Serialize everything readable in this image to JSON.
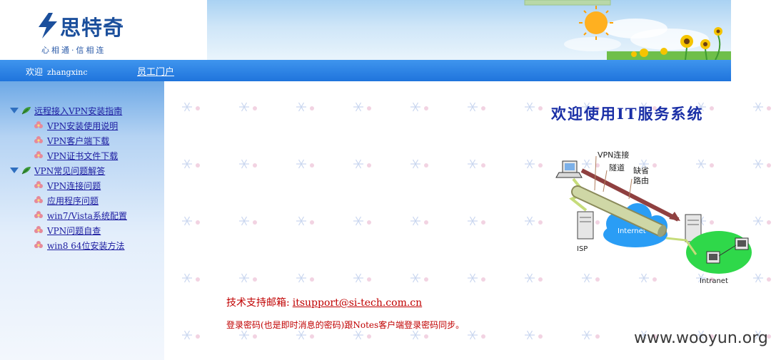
{
  "header": {
    "logo_name": "思特奇",
    "logo_slogan": "心相通·信相连"
  },
  "navbar": {
    "welcome_label": "欢迎",
    "username": "zhangxinc",
    "portal_link": "员工门户"
  },
  "sidebar": {
    "groups": [
      {
        "label": "远程接入VPN安装指南",
        "items": [
          {
            "label": "VPN安装使用说明"
          },
          {
            "label": "VPN客户端下载"
          },
          {
            "label": "VPN证书文件下载"
          }
        ]
      },
      {
        "label": "VPN常见问题解答",
        "items": [
          {
            "label": "VPN连接问题"
          },
          {
            "label": "应用程序问题"
          },
          {
            "label": "win7/Vista系统配置"
          },
          {
            "label": "VPN问题自查"
          },
          {
            "label": "win8 64位安装方法"
          }
        ]
      }
    ]
  },
  "main": {
    "title": "欢迎使用IT服务系统",
    "diagram": {
      "vpn_label": "VPN连接",
      "tunnel_label": "隧道",
      "route_label_1": "缺省",
      "route_label_2": "路由",
      "internet_label": "Internet",
      "isp_label": "ISP",
      "intranet_label": "Intranet"
    },
    "support_label": "技术支持邮箱:",
    "support_email": "itsupport@si-tech.com.cn",
    "password_note": "登录密码(也是即时消息的密码)跟Notes客户端登录密码同步。"
  },
  "watermark": "www.wooyun.org",
  "colors": {
    "nav_blue": "#1f74dc",
    "title_blue": "#1a2fa6",
    "link_blue": "#1b1ba0",
    "support_red": "#c00000",
    "intranet_green": "#2fd84a"
  }
}
